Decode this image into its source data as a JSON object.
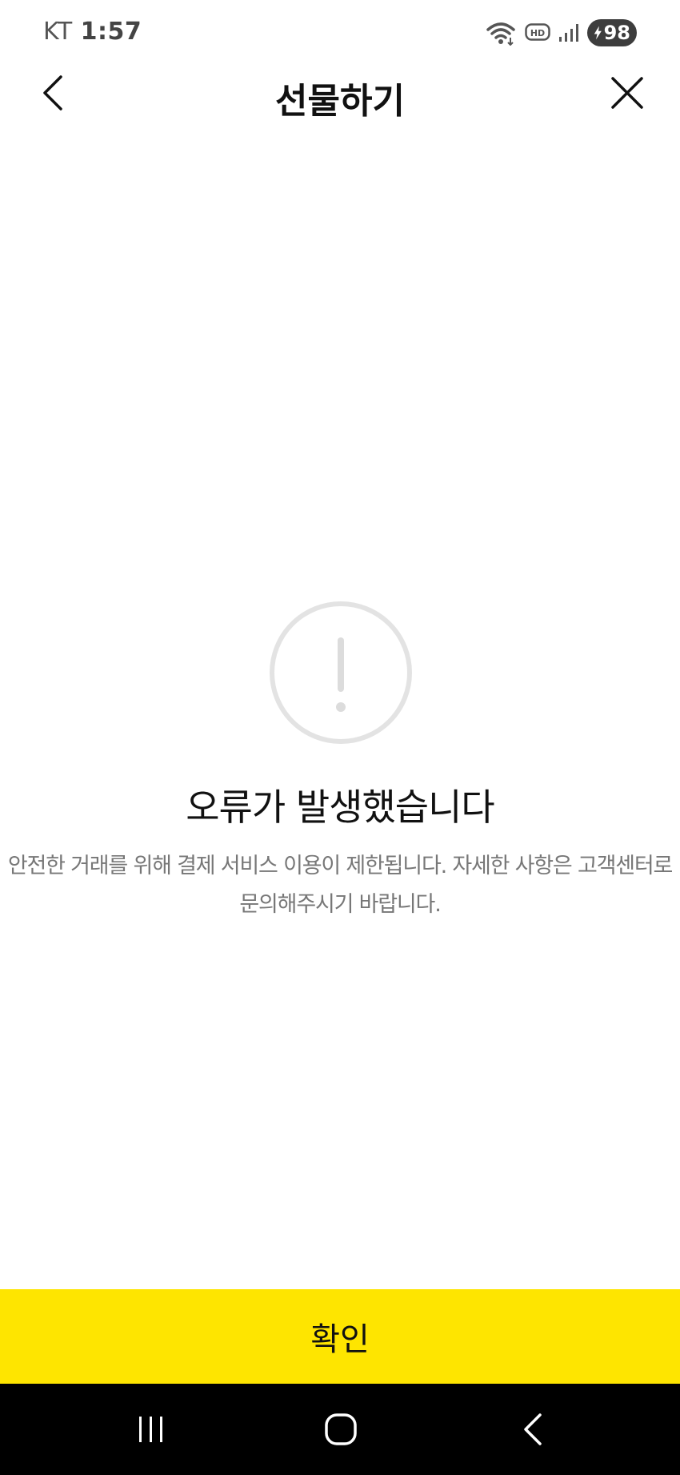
{
  "status_bar": {
    "carrier": "KT",
    "time": "1:57",
    "battery_level": "98",
    "icons": [
      "wifi-icon",
      "hd-voice-icon",
      "signal-icon",
      "battery-charging-icon"
    ]
  },
  "header": {
    "title": "선물하기",
    "back_icon": "chevron-left-icon",
    "close_icon": "close-icon"
  },
  "error": {
    "icon": "exclamation-circle-icon",
    "title": "오류가 발생했습니다",
    "message_line1": "안전한 거래를 위해 결제 서비스 이용이 제한됩니다. 자세한 사항은 고객센터로",
    "message_line2": "문의해주시기 바랍니다."
  },
  "confirm_button": {
    "label": "확인",
    "color": "#fee500"
  },
  "nav_bar": {
    "icons": [
      "recents-icon",
      "home-icon",
      "back-icon"
    ]
  }
}
